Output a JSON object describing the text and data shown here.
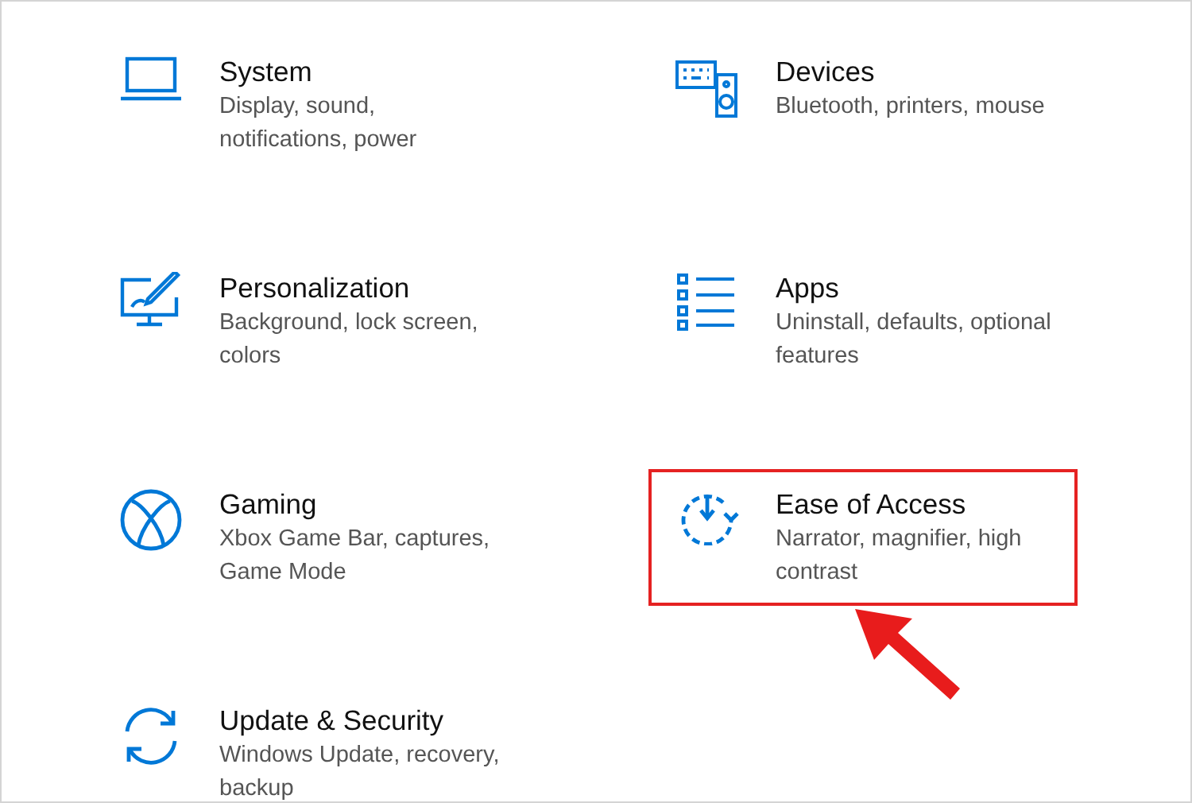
{
  "settings": [
    {
      "kind": "system",
      "title": "System",
      "description": "Display, sound, notifications, power",
      "highlighted": false
    },
    {
      "kind": "devices",
      "title": "Devices",
      "description": "Bluetooth, printers, mouse",
      "highlighted": false
    },
    {
      "kind": "personalization",
      "title": "Personalization",
      "description": "Background, lock screen, colors",
      "highlighted": false
    },
    {
      "kind": "apps",
      "title": "Apps",
      "description": "Uninstall, defaults, optional features",
      "highlighted": false
    },
    {
      "kind": "gaming",
      "title": "Gaming",
      "description": "Xbox Game Bar, captures, Game Mode",
      "highlighted": false
    },
    {
      "kind": "ease",
      "title": "Ease of Access",
      "description": "Narrator, magnifier, high contrast",
      "highlighted": true
    },
    {
      "kind": "update",
      "title": "Update & Security",
      "description": "Windows Update, recovery, backup",
      "highlighted": false
    }
  ]
}
